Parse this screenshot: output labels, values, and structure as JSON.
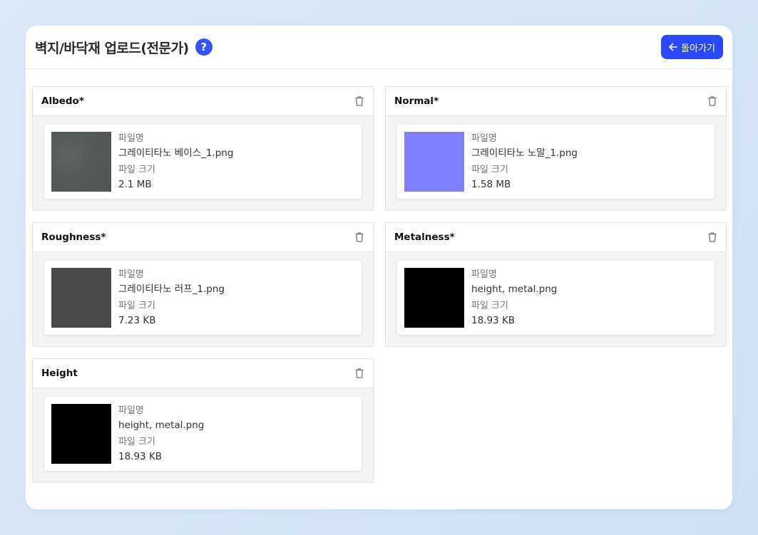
{
  "header": {
    "title": "벽지/바닥재 업로드(전문가)",
    "help_symbol": "?",
    "back_label": "돌아가기"
  },
  "labels": {
    "file_name": "파일명",
    "file_size": "파일 크기"
  },
  "slots": [
    {
      "title": "Albedo*",
      "file_name": "그레이티타노 베이스_1.png",
      "file_size": "2.1 MB",
      "thumb_color": "#555a5a"
    },
    {
      "title": "Normal*",
      "file_name": "그레이티타노 노말_1.png",
      "file_size": "1.58 MB",
      "thumb_color": "#8080ff"
    },
    {
      "title": "Roughness*",
      "file_name": "그레이티타노 러프_1.png",
      "file_size": "7.23 KB",
      "thumb_color": "#4a4a4a"
    },
    {
      "title": "Metalness*",
      "file_name": "height, metal.png",
      "file_size": "18.93 KB",
      "thumb_color": "#000000"
    },
    {
      "title": "Height",
      "file_name": "height, metal.png",
      "file_size": "18.93 KB",
      "thumb_color": "#000000"
    }
  ],
  "colors": {
    "accent": "#2a48ff",
    "help": "#3354ff"
  },
  "icons": {
    "help": "question-icon",
    "back": "arrow-left-icon",
    "delete": "trash-icon"
  }
}
